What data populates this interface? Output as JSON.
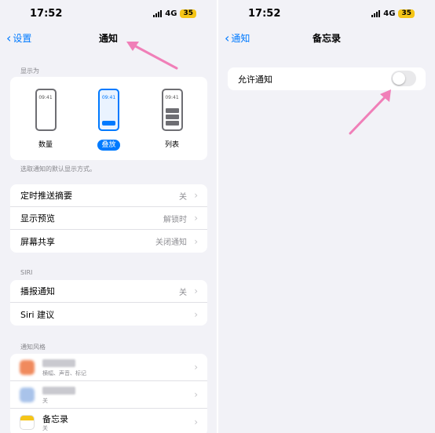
{
  "left": {
    "status": {
      "time": "17:52",
      "network": "4G",
      "battery": "35"
    },
    "nav": {
      "back_label": "设置",
      "title": "通知"
    },
    "display_as": {
      "section_label": "显示为",
      "options": [
        {
          "label": "数量",
          "phone_time": "09:41",
          "selected": false
        },
        {
          "label": "叠放",
          "phone_time": "09:41",
          "selected": true
        },
        {
          "label": "列表",
          "phone_time": "09:41",
          "selected": false
        }
      ],
      "footer": "选取通知的默认显示方式。"
    },
    "settings": [
      {
        "label": "定时推送摘要",
        "value": "关"
      },
      {
        "label": "显示预览",
        "value": "解锁时"
      },
      {
        "label": "屏幕共享",
        "value": "关闭通知"
      }
    ],
    "siri": {
      "section_label": "SIRI",
      "rows": [
        {
          "label": "播报通知",
          "value": "关"
        },
        {
          "label": "Siri 建议",
          "value": ""
        }
      ]
    },
    "notification_style": {
      "section_label": "通知风格",
      "apps": [
        {
          "name": "",
          "sub": "横幅、声音、标记",
          "icon_color": "#f08a5d"
        },
        {
          "name": "",
          "sub": "关",
          "icon_color": "#a9c3ea"
        },
        {
          "name": "备忘录",
          "sub": "关",
          "icon_color": "#f5c518"
        }
      ]
    }
  },
  "right": {
    "status": {
      "time": "17:52",
      "network": "4G",
      "battery": "35"
    },
    "nav": {
      "back_label": "通知",
      "title": "备忘录"
    },
    "allow": {
      "label": "允许通知",
      "enabled": false
    }
  },
  "colors": {
    "accent": "#007aff",
    "background": "#f2f2f7",
    "arrow": "#f07fb8"
  }
}
